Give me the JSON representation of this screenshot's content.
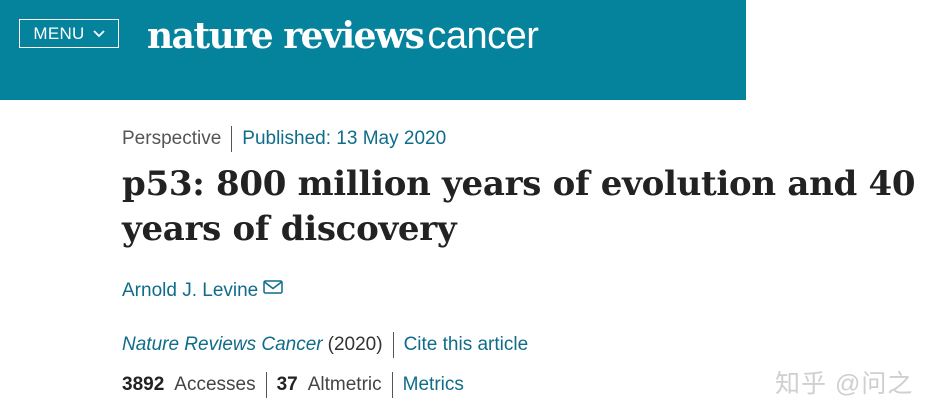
{
  "header": {
    "menu_label": "MENU",
    "menu_icon": "chevron-down-icon",
    "logo_bold": "nature reviews",
    "logo_light": "cancer",
    "background_color": "#05829c"
  },
  "article": {
    "type": "Perspective",
    "published": "Published: 13 May 2020",
    "title": "p53: 800 million years of evolution and 40 years of discovery",
    "author": "Arnold J. Levine",
    "author_icon": "envelope-icon",
    "journal": "Nature Reviews Cancer",
    "year": "(2020)",
    "cite_label": "Cite this article",
    "accesses_count": "3892",
    "accesses_label": "Accesses",
    "altmetric_count": "37",
    "altmetric_label": "Altmetric",
    "metrics_label": "Metrics"
  },
  "watermark": "知乎 @问之",
  "colors": {
    "link": "#0f6c8a",
    "text": "#222222"
  }
}
